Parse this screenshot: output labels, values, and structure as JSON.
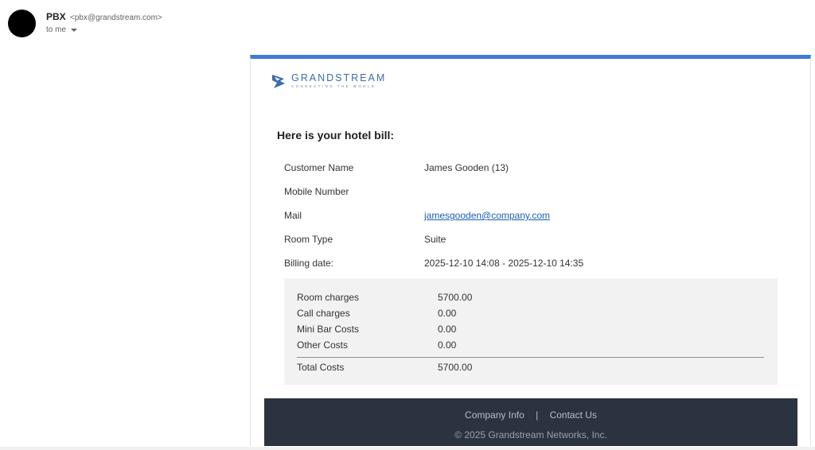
{
  "sender": {
    "name": "PBX",
    "email": "<pbx@grandstream.com>",
    "recipient_label": "to me"
  },
  "email": {
    "accent_color": "#3d7ad8",
    "logo": {
      "brand": "GRANDSTREAM",
      "tagline": "CONNECTING THE WORLD"
    },
    "heading": "Here is your hotel bill:",
    "info": {
      "customer_name_label": "Customer Name",
      "customer_name_value": "James Gooden (13)",
      "mobile_label": "Mobile Number",
      "mobile_value": "",
      "mail_label": "Mail",
      "mail_value": "jamesgooden@company.com",
      "room_type_label": "Room Type",
      "room_type_value": "Suite",
      "billing_date_label": "Billing date:",
      "billing_date_value": "2025-12-10 14:08 - 2025-12-10 14:35"
    },
    "costs": {
      "room_label": "Room charges",
      "room_value": "5700.00",
      "call_label": "Call charges",
      "call_value": "0.00",
      "minibar_label": "Mini Bar Costs",
      "minibar_value": "0.00",
      "other_label": "Other Costs",
      "other_value": "0.00",
      "total_label": "Total Costs",
      "total_value": "5700.00"
    },
    "footer": {
      "company_info": "Company Info",
      "separator": "|",
      "contact_us": "Contact Us",
      "copyright": "© 2025 Grandstream Networks, Inc."
    }
  }
}
